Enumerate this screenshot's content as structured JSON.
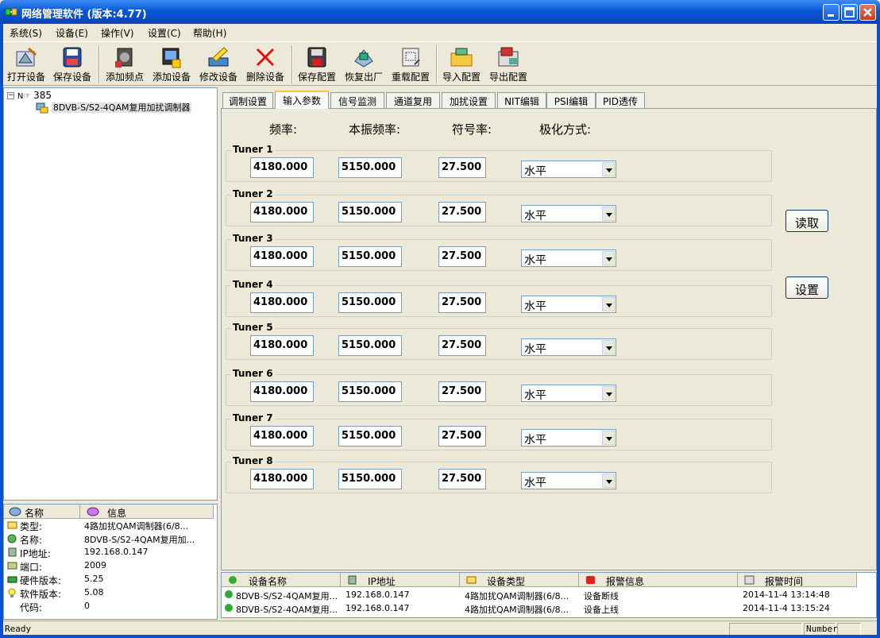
{
  "window": {
    "title": "网络管理软件 (版本:4.77)"
  },
  "menu": [
    "系统(S)",
    "设备(E)",
    "操作(V)",
    "设置(C)",
    "帮助(H)"
  ],
  "toolbar": [
    {
      "label": "打开设备",
      "icon": "open-device-icon"
    },
    {
      "label": "保存设备",
      "icon": "save-device-icon"
    },
    {
      "label": "添加频点",
      "icon": "add-frequency-icon"
    },
    {
      "label": "添加设备",
      "icon": "add-device-icon"
    },
    {
      "label": "修改设备",
      "icon": "edit-device-icon"
    },
    {
      "label": "删除设备",
      "icon": "delete-device-icon"
    },
    {
      "label": "保存配置",
      "icon": "save-config-icon"
    },
    {
      "label": "恢复出厂",
      "icon": "factory-reset-icon"
    },
    {
      "label": "重载配置",
      "icon": "reload-config-icon"
    },
    {
      "label": "导入配置",
      "icon": "import-config-icon"
    },
    {
      "label": "导出配置",
      "icon": "export-config-icon"
    }
  ],
  "tree": {
    "root": "385",
    "root_prefix": "N",
    "child": "8DVB-S/S2-4QAM复用加扰调制器"
  },
  "props": {
    "headers": [
      "名称",
      "信息"
    ],
    "rows": [
      {
        "name": "类型:",
        "value": "4路加扰QAM调制器(6/8..."
      },
      {
        "name": "名称:",
        "value": "8DVB-S/S2-4QAM复用加..."
      },
      {
        "name": "IP地址:",
        "value": "192.168.0.147"
      },
      {
        "name": "端口:",
        "value": "2009"
      },
      {
        "name": "硬件版本:",
        "value": "5.25"
      },
      {
        "name": "软件版本:",
        "value": "5.08"
      },
      {
        "name": "代码:",
        "value": "0"
      }
    ]
  },
  "tabs": [
    "调制设置",
    "输入参数",
    "信号监测",
    "通道复用",
    "加扰设置",
    "NIT编辑",
    "PSI编辑",
    "PID透传"
  ],
  "active_tab": 1,
  "columns": {
    "freq": "频率:",
    "lo": "本振频率:",
    "symrate": "符号率:",
    "polar": "极化方式:"
  },
  "tuners": [
    {
      "label": "Tuner 1",
      "freq": "4180.000",
      "lo": "5150.000",
      "symrate": "27.500",
      "polar": "水平"
    },
    {
      "label": "Tuner 2",
      "freq": "4180.000",
      "lo": "5150.000",
      "symrate": "27.500",
      "polar": "水平"
    },
    {
      "label": "Tuner 3",
      "freq": "4180.000",
      "lo": "5150.000",
      "symrate": "27.500",
      "polar": "水平"
    },
    {
      "label": "Tuner 4",
      "freq": "4180.000",
      "lo": "5150.000",
      "symrate": "27.500",
      "polar": "水平"
    },
    {
      "label": "Tuner 5",
      "freq": "4180.000",
      "lo": "5150.000",
      "symrate": "27.500",
      "polar": "水平"
    },
    {
      "label": "Tuner 6",
      "freq": "4180.000",
      "lo": "5150.000",
      "symrate": "27.500",
      "polar": "水平"
    },
    {
      "label": "Tuner 7",
      "freq": "4180.000",
      "lo": "5150.000",
      "symrate": "27.500",
      "polar": "水平"
    },
    {
      "label": "Tuner 8",
      "freq": "4180.000",
      "lo": "5150.000",
      "symrate": "27.500",
      "polar": "水平"
    }
  ],
  "buttons": {
    "read": "读取",
    "set": "设置"
  },
  "alarms": {
    "headers": [
      "设备名称",
      "IP地址",
      "设备类型",
      "报警信息",
      "报警时间"
    ],
    "rows": [
      {
        "name": "8DVB-S/S2-4QAM复用...",
        "ip": "192.168.0.147",
        "type": "4路加扰QAM调制器(6/8...",
        "msg": "设备断线",
        "time": "2014-11-4 13:14:48"
      },
      {
        "name": "8DVB-S/S2-4QAM复用...",
        "ip": "192.168.0.147",
        "type": "4路加扰QAM调制器(6/8...",
        "msg": "设备上线",
        "time": "2014-11-4 13:15:24"
      }
    ]
  },
  "status": {
    "text": "Ready",
    "number": "Number"
  },
  "colors": {
    "title_blue": "#0a57d8",
    "panel_bg": "#ece9d8",
    "tab_accent": "#ffc83c"
  }
}
